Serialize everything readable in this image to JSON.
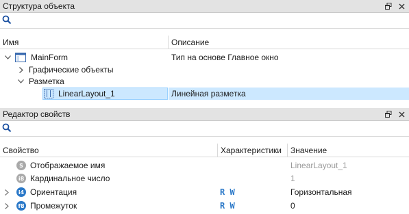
{
  "object_panel": {
    "title": "Структура объекта",
    "columns": [
      "Имя",
      "Описание"
    ],
    "rows": [
      {
        "name": "MainForm",
        "description": "Тип на основе Главное окно",
        "icon": "window-icon"
      },
      {
        "name": "Графические объекты",
        "description": ""
      },
      {
        "name": "Разметка",
        "description": ""
      },
      {
        "name": "LinearLayout_1",
        "description": "Линейная разметка",
        "icon": "linear-layout-icon"
      }
    ]
  },
  "property_panel": {
    "title": "Редактор свойств",
    "columns": [
      "Свойство",
      "Характеристики",
      "Значение"
    ],
    "rows": [
      {
        "name": "Отображаемое имя",
        "badge": "S",
        "badge_color": "#a9a9a9",
        "flags": "",
        "value": "LinearLayout_1",
        "value_grey": true
      },
      {
        "name": "Кардинальное число",
        "badge": "i8",
        "badge_color": "#a9a9a9",
        "flags": "",
        "value": "1",
        "value_grey": true
      },
      {
        "name": "Ориентация",
        "badge": "i4",
        "badge_color": "#2a78c8",
        "flags": "R W",
        "value": "Горизонтальная",
        "value_grey": false
      },
      {
        "name": "Промежуток",
        "badge": "f8",
        "badge_color": "#2a78c8",
        "flags": "R W",
        "value": "0",
        "value_grey": false
      }
    ]
  },
  "colors": {
    "selection": "#cce8ff",
    "accent": "#2a78c8",
    "header_bg": "#e3e3e3"
  }
}
